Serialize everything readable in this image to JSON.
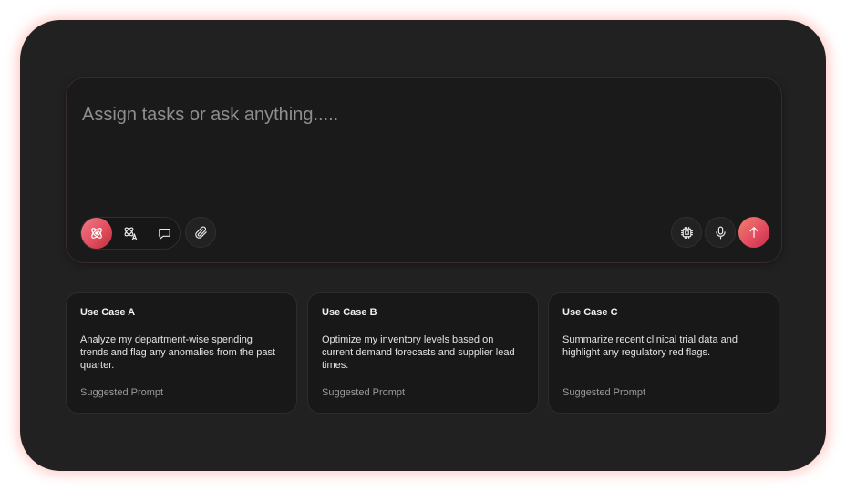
{
  "composer": {
    "placeholder": "Assign tasks or ask anything.....",
    "value": "",
    "modes": [
      {
        "icon": "atom-icon",
        "active": true
      },
      {
        "icon": "atom-translate-icon",
        "active": false
      },
      {
        "icon": "chat-bubble-icon",
        "active": false
      }
    ],
    "left_actions": [
      {
        "icon": "paperclip-icon"
      }
    ],
    "right_actions": [
      {
        "icon": "cpu-chip-icon"
      },
      {
        "icon": "microphone-icon"
      },
      {
        "icon": "arrow-up-icon"
      }
    ]
  },
  "cards": [
    {
      "title": "Use Case A",
      "body": "Analyze my department-wise spending trends and flag any anomalies from the past quarter.",
      "footer": "Suggested Prompt"
    },
    {
      "title": "Use Case B",
      "body": "Optimize my inventory levels based on current demand forecasts and supplier lead times.",
      "footer": "Suggested Prompt"
    },
    {
      "title": "Use Case C",
      "body": "Summarize recent clinical trial data and highlight any regulatory red flags.",
      "footer": "Suggested Prompt"
    }
  ],
  "colors": {
    "panel": "#212121",
    "accent": "#e24a5e",
    "glow": "#ff786e"
  }
}
